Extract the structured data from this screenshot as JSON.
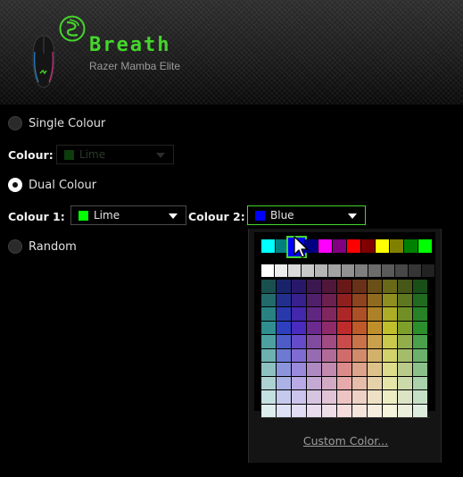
{
  "header": {
    "title": "Breath",
    "device": "Razer Mamba Elite",
    "brand_color": "#44d62c",
    "logo_icon": "razer-snake-logo-icon",
    "device_icon": "mouse-icon"
  },
  "options": {
    "single": {
      "label": "Single Colour",
      "selected": false
    },
    "dual": {
      "label": "Dual Colour",
      "selected": true
    },
    "random": {
      "label": "Random",
      "selected": false
    }
  },
  "single_colour": {
    "label": "Colour:",
    "value": "Lime",
    "swatch": "#0d3d0d",
    "enabled": false
  },
  "colour1": {
    "label": "Colour 1:",
    "value": "Lime",
    "swatch": "#00ff00"
  },
  "colour2": {
    "label": "Colour 2:",
    "value": "Blue",
    "swatch": "#0000ff",
    "open": true
  },
  "palette": {
    "top_row": [
      "#00ffff",
      "#008080",
      "#0000ff",
      "#000080",
      "#ff00ff",
      "#800080",
      "#ff0000",
      "#800000",
      "#ffff00",
      "#808000",
      "#008000",
      "#00ff00"
    ],
    "selected_top_index": 2,
    "grays": [
      "#ffffff",
      "#ededed",
      "#dadada",
      "#c8c8c8",
      "#b5b5b5",
      "#a3a3a3",
      "#919191",
      "#7e7e7e",
      "#6c6c6c",
      "#5a5a5a",
      "#474747",
      "#353535",
      "#222222"
    ],
    "hues": [
      "#2f8f8f",
      "#2e3fbf",
      "#4a2bbf",
      "#6b2b8f",
      "#8f2b6b",
      "#bf2b2b",
      "#bf5a2b",
      "#bf8f2b",
      "#bfbf2b",
      "#7f9f2b",
      "#2b8f2b"
    ],
    "custom_label": "Custom Color..."
  }
}
